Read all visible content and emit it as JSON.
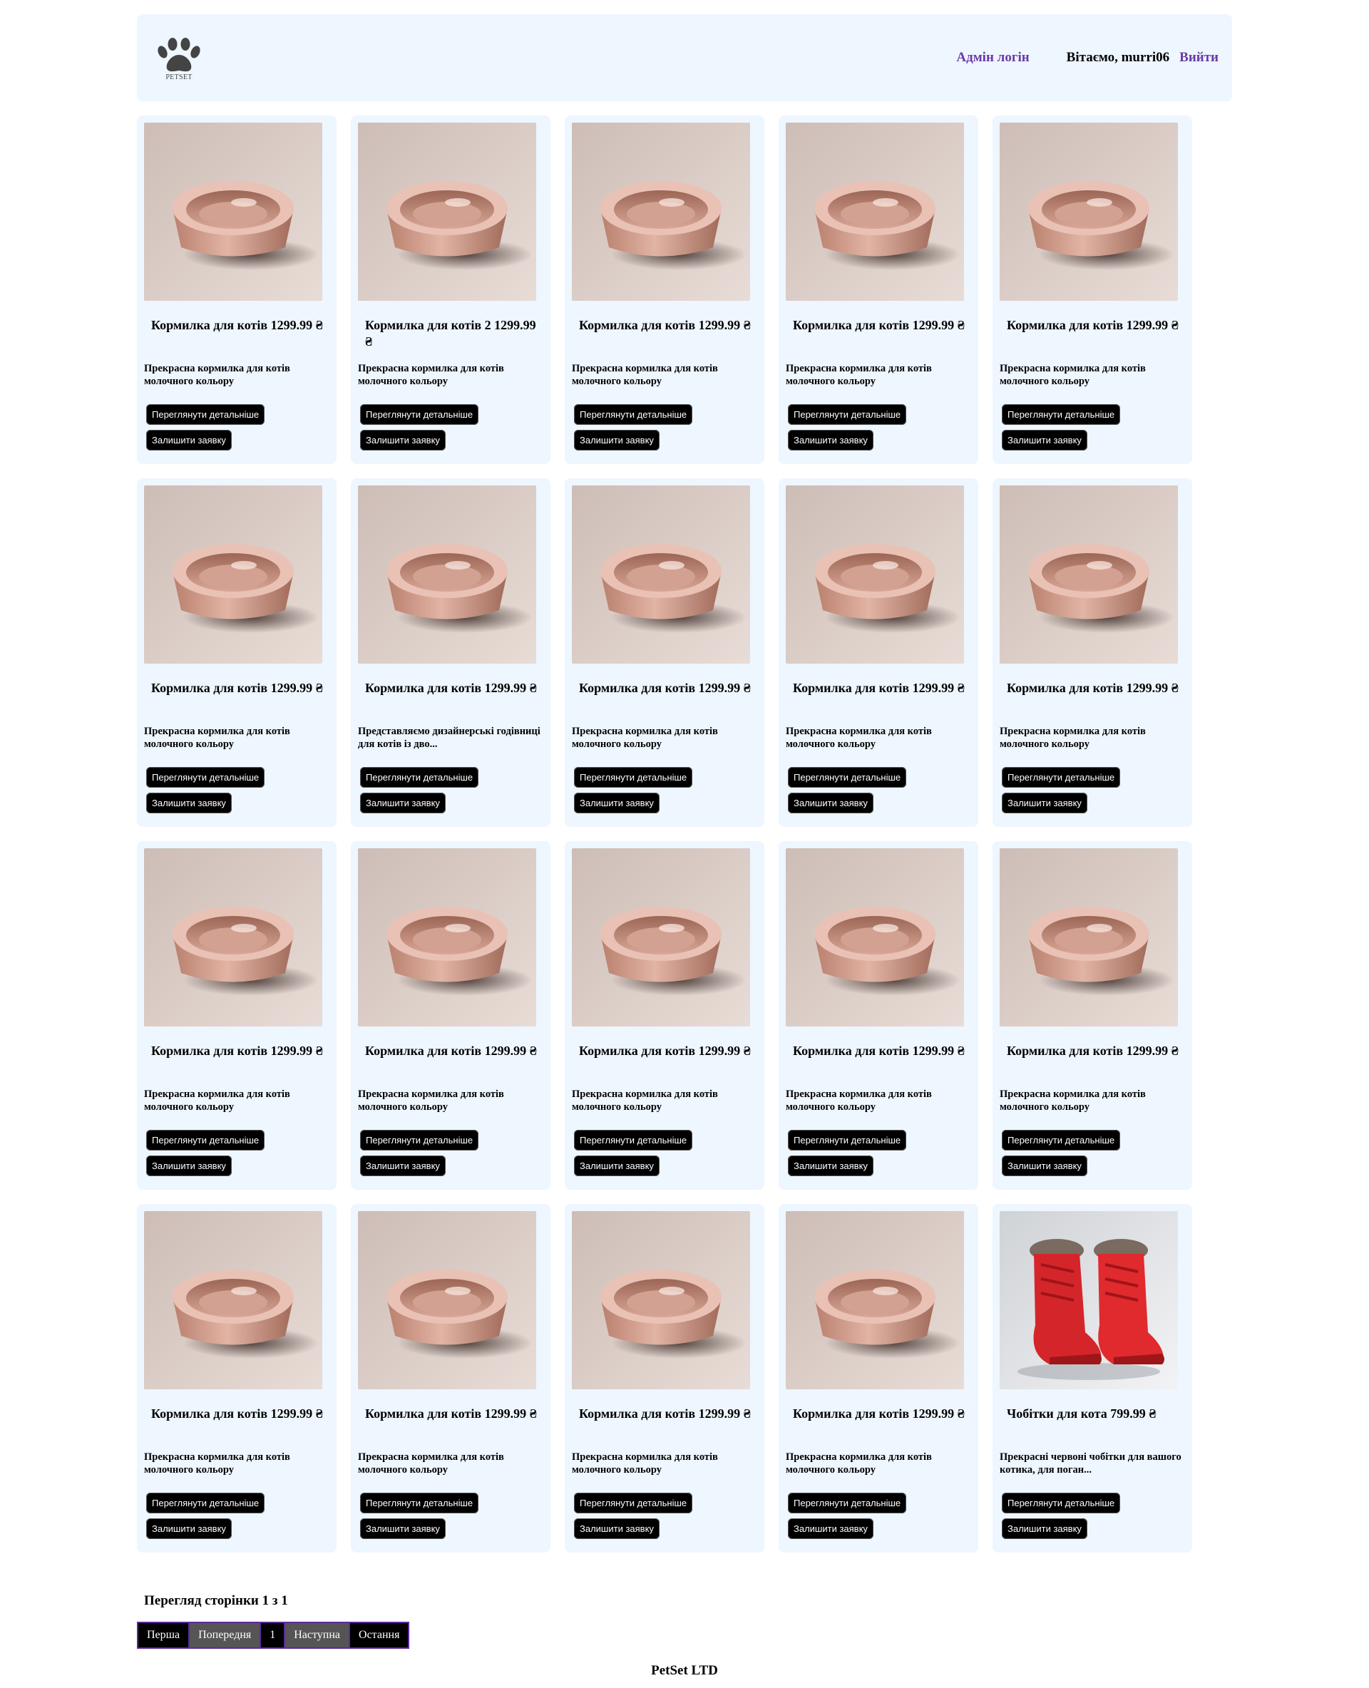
{
  "header": {
    "logo_text": "PETSET",
    "admin_link": "Адмін логін",
    "greeting": "Вітаємо, murri06",
    "logout": "Вийти"
  },
  "products": [
    {
      "title": "Кормилка для котів 1299.99 ₴",
      "desc": "Прекрасна кормилка для котів молочного кольору",
      "details_btn": "Переглянути детальніше",
      "order_btn": "Залишити заявку",
      "image": "bowl"
    },
    {
      "title": "Кормилка для котів 2 1299.99 ₴",
      "desc": "Прекрасна кормилка для котів молочного кольору",
      "details_btn": "Переглянути детальніше",
      "order_btn": "Залишити заявку",
      "image": "bowl"
    },
    {
      "title": "Кормилка для котів 1299.99 ₴",
      "desc": "Прекрасна кормилка для котів молочного кольору",
      "details_btn": "Переглянути детальніше",
      "order_btn": "Залишити заявку",
      "image": "bowl"
    },
    {
      "title": "Кормилка для котів 1299.99 ₴",
      "desc": "Прекрасна кормилка для котів молочного кольору",
      "details_btn": "Переглянути детальніше",
      "order_btn": "Залишити заявку",
      "image": "bowl"
    },
    {
      "title": "Кормилка для котів 1299.99 ₴",
      "desc": "Прекрасна кормилка для котів молочного кольору",
      "details_btn": "Переглянути детальніше",
      "order_btn": "Залишити заявку",
      "image": "bowl"
    },
    {
      "title": "Кормилка для котів 1299.99 ₴",
      "desc": "Прекрасна кормилка для котів молочного кольору",
      "details_btn": "Переглянути детальніше",
      "order_btn": "Залишити заявку",
      "image": "bowl"
    },
    {
      "title": "Кормилка для котів 1299.99 ₴",
      "desc": "Представляємо дизайнерські годівниці для котів із дво...",
      "details_btn": "Переглянути детальніше",
      "order_btn": "Залишити заявку",
      "image": "bowl"
    },
    {
      "title": "Кормилка для котів 1299.99 ₴",
      "desc": "Прекрасна кормилка для котів молочного кольору",
      "details_btn": "Переглянути детальніше",
      "order_btn": "Залишити заявку",
      "image": "bowl"
    },
    {
      "title": "Кормилка для котів 1299.99 ₴",
      "desc": "Прекрасна кормилка для котів молочного кольору",
      "details_btn": "Переглянути детальніше",
      "order_btn": "Залишити заявку",
      "image": "bowl"
    },
    {
      "title": "Кормилка для котів 1299.99 ₴",
      "desc": "Прекрасна кормилка для котів молочного кольору",
      "details_btn": "Переглянути детальніше",
      "order_btn": "Залишити заявку",
      "image": "bowl"
    },
    {
      "title": "Кормилка для котів 1299.99 ₴",
      "desc": "Прекрасна кормилка для котів молочного кольору",
      "details_btn": "Переглянути детальніше",
      "order_btn": "Залишити заявку",
      "image": "bowl"
    },
    {
      "title": "Кормилка для котів 1299.99 ₴",
      "desc": "Прекрасна кормилка для котів молочного кольору",
      "details_btn": "Переглянути детальніше",
      "order_btn": "Залишити заявку",
      "image": "bowl"
    },
    {
      "title": "Кормилка для котів 1299.99 ₴",
      "desc": "Прекрасна кормилка для котів молочного кольору",
      "details_btn": "Переглянути детальніше",
      "order_btn": "Залишити заявку",
      "image": "bowl"
    },
    {
      "title": "Кормилка для котів 1299.99 ₴",
      "desc": "Прекрасна кормилка для котів молочного кольору",
      "details_btn": "Переглянути детальніше",
      "order_btn": "Залишити заявку",
      "image": "bowl"
    },
    {
      "title": "Кормилка для котів 1299.99 ₴",
      "desc": "Прекрасна кормилка для котів молочного кольору",
      "details_btn": "Переглянути детальніше",
      "order_btn": "Залишити заявку",
      "image": "bowl"
    },
    {
      "title": "Кормилка для котів 1299.99 ₴",
      "desc": "Прекрасна кормилка для котів молочного кольору",
      "details_btn": "Переглянути детальніше",
      "order_btn": "Залишити заявку",
      "image": "bowl"
    },
    {
      "title": "Кормилка для котів 1299.99 ₴",
      "desc": "Прекрасна кормилка для котів молочного кольору",
      "details_btn": "Переглянути детальніше",
      "order_btn": "Залишити заявку",
      "image": "bowl"
    },
    {
      "title": "Кормилка для котів 1299.99 ₴",
      "desc": "Прекрасна кормилка для котів молочного кольору",
      "details_btn": "Переглянути детальніше",
      "order_btn": "Залишити заявку",
      "image": "bowl"
    },
    {
      "title": "Кормилка для котів 1299.99 ₴",
      "desc": "Прекрасна кормилка для котів молочного кольору",
      "details_btn": "Переглянути детальніше",
      "order_btn": "Залишити заявку",
      "image": "bowl"
    },
    {
      "title": "Чобітки для кота 799.99 ₴",
      "desc": "Прекрасні червоні чобітки для вашого котика, для поган...",
      "details_btn": "Переглянути детальніше",
      "order_btn": "Залишити заявку",
      "image": "boots"
    }
  ],
  "pagination": {
    "info": "Перегляд сторінки 1 з 1",
    "first": "Перша",
    "prev": "Попередня",
    "current": "1",
    "next": "Наступна",
    "last": "Остання"
  },
  "footer": {
    "text": "PetSet LTD"
  },
  "colors": {
    "panel_bg": "#eef6ff",
    "link": "#6a3aa6",
    "button_bg": "#000000"
  }
}
